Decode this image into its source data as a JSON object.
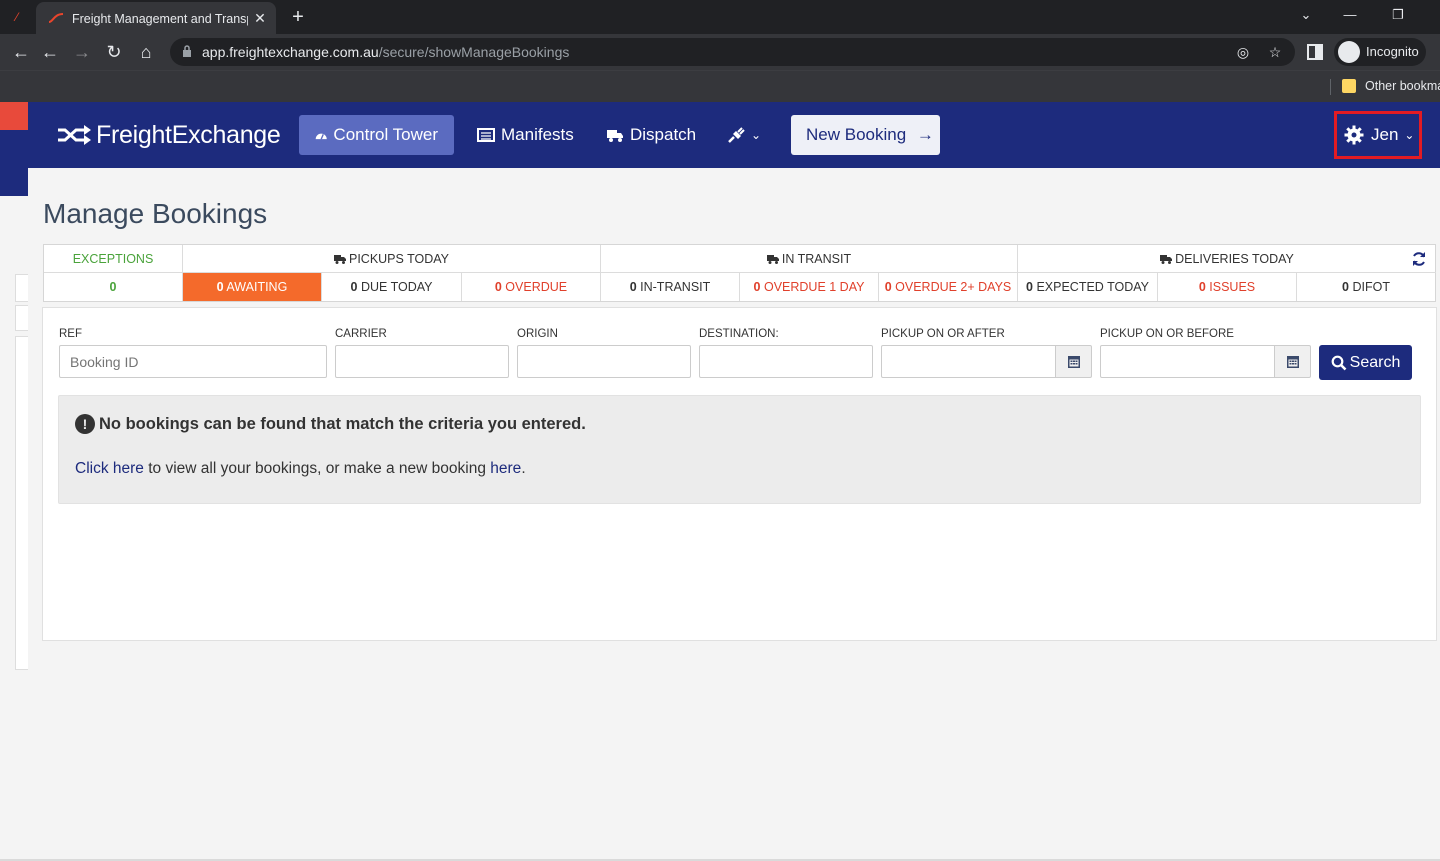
{
  "browser": {
    "tab_title": "Freight Management and Transport",
    "tab_close": "✕",
    "new_tab": "+",
    "url_host": "app.freightexchange.com.au",
    "url_path": "/secure/showManageBookings",
    "profile_label": "Incognito",
    "bookmark_folder": "Other bookmarks"
  },
  "app": {
    "brand": "FreightExchange",
    "nav": {
      "control_tower": "Control Tower",
      "manifests": "Manifests",
      "dispatch": "Dispatch",
      "new_booking": "New Booking",
      "new_booking_arrow": "→",
      "user": "Jen"
    },
    "colors": {
      "navbar": "#1d2b7d",
      "active_nav": "#5b6bc0",
      "accent_orange": "#f46a2b",
      "alert_red": "#e0402b",
      "ok_green": "#4aa33b",
      "highlight_box": "#e31b23"
    }
  },
  "page": {
    "title": "Manage Bookings",
    "stats": {
      "exceptions": {
        "label": "EXCEPTIONS",
        "value": "0"
      },
      "pickups_today": {
        "label": "PICKUPS TODAY",
        "awaiting": {
          "num": "0",
          "text": "AWAITING"
        },
        "due_today": {
          "num": "0",
          "text": "DUE TODAY"
        },
        "overdue": {
          "num": "0",
          "text": "OVERDUE"
        }
      },
      "in_transit": {
        "label": "IN TRANSIT",
        "in_transit": {
          "num": "0",
          "text": "IN-TRANSIT"
        },
        "overdue_1_day": {
          "num": "0",
          "text": "OVERDUE 1 DAY"
        },
        "overdue_2_days": {
          "num": "0",
          "text": "OVERDUE 2+ DAYS"
        }
      },
      "deliveries_today": {
        "label": "DELIVERIES TODAY",
        "expected_today": {
          "num": "0",
          "text": "EXPECTED TODAY"
        },
        "issues": {
          "num": "0",
          "text": "ISSUES"
        },
        "difot": {
          "num": "0",
          "text": "DIFOT"
        }
      }
    },
    "filters": {
      "ref": {
        "label": "REF",
        "placeholder": "Booking ID",
        "value": ""
      },
      "carrier": {
        "label": "CARRIER",
        "value": ""
      },
      "origin": {
        "label": "ORIGIN",
        "value": ""
      },
      "destination": {
        "label": "DESTINATION:",
        "value": ""
      },
      "pickup_after": {
        "label": "PICKUP ON OR AFTER",
        "value": ""
      },
      "pickup_before": {
        "label": "PICKUP ON OR BEFORE",
        "value": ""
      },
      "search_button": "Search"
    },
    "alert": {
      "message": "No bookings can be found that match the criteria you entered.",
      "link_here_1": "Click here",
      "middle_text": " to view all your bookings, or make a new booking ",
      "link_here_2": "here",
      "end_text": "."
    }
  }
}
